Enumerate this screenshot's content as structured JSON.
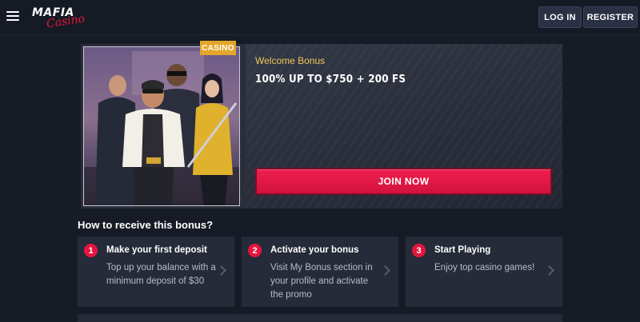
{
  "header": {
    "logo_word1": "MAFIA",
    "logo_word2": "Casino",
    "login_label": "LOG IN",
    "register_label": "REGISTER"
  },
  "offer": {
    "badge": "CASINO",
    "welcome_label": "Welcome Bonus",
    "title": "100% UP TO $750 + 200 FS",
    "join_label": "JOIN NOW"
  },
  "how_to": {
    "title": "How to receive this bonus?",
    "steps": [
      {
        "number": "1",
        "title": "Make your first deposit",
        "text": "Top up your balance with a minimum deposit of $30"
      },
      {
        "number": "2",
        "title": "Activate your bonus",
        "text": "Visit My Bonus section in your profile and activate the promo"
      },
      {
        "number": "3",
        "title": "Start Playing",
        "text": "Enjoy top casino games!"
      }
    ]
  },
  "colors": {
    "accent_red": "#e4153e",
    "badge_gold": "#e3a62a",
    "welcome_gold": "#f0c65a",
    "background": "#171b25"
  },
  "icons": {
    "menu": "hamburger-menu-icon",
    "chevron": "chevron-right-icon"
  }
}
